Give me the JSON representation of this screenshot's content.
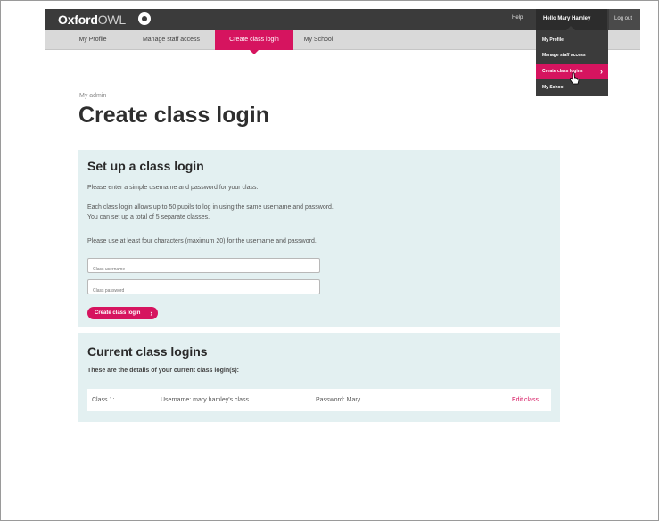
{
  "header": {
    "logo_main": "Oxford",
    "logo_sub": "OWL",
    "help": "Help",
    "user": "Hello Mary Hamley",
    "logout": "Log out"
  },
  "subnav": {
    "tabs": [
      {
        "label": "My Profile"
      },
      {
        "label": "Manage staff access"
      },
      {
        "label": "Create class login"
      },
      {
        "label": "My School"
      }
    ],
    "active_tab": "Create class login"
  },
  "user_menu": {
    "items": [
      {
        "label": "My Profile"
      },
      {
        "label": "Manage staff access"
      },
      {
        "label": "Create class logins"
      },
      {
        "label": "My School"
      }
    ],
    "active_item": "Create class logins"
  },
  "breadcrumb": "My admin",
  "page_title": "Create class login",
  "setup": {
    "heading": "Set up a class login",
    "intro": "Please enter a simple username and password for your class.",
    "info_line1": "Each class login allows up to 50 pupils to log in using the same username and password.",
    "info_line2": "You can set up a total of 5 separate classes.",
    "rules": "Please use at least four characters (maximum 20) for the username and password.",
    "username_placeholder": "Class username",
    "password_placeholder": "Class password",
    "submit_label": "Create class login"
  },
  "current": {
    "heading": "Current class logins",
    "subheading": "These are the details of your current class login(s):",
    "rows": [
      {
        "class": "Class 1:",
        "username": "Username: mary hamley's class",
        "password": "Password: Mary",
        "action": "Edit class"
      }
    ]
  },
  "colors": {
    "accent": "#d6145f",
    "topbar": "#3b3b3b",
    "panel": "#e3f0f1"
  }
}
